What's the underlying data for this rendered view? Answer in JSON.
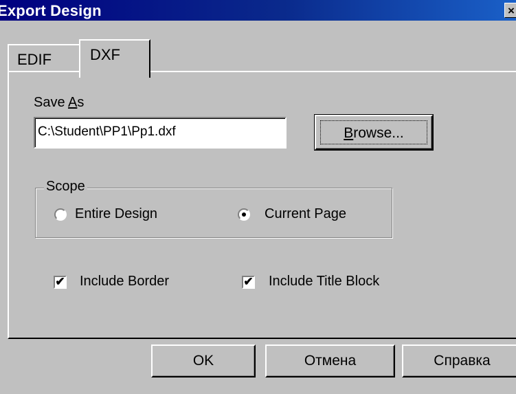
{
  "window": {
    "title": "Export Design",
    "close_glyph": "×"
  },
  "tabs": [
    {
      "label": "EDIF",
      "selected": false
    },
    {
      "label": "DXF",
      "selected": true
    }
  ],
  "save_as": {
    "label_prefix": "Save ",
    "label_mnemonic": "A",
    "label_suffix": "s",
    "value": "C:\\Student\\PP1\\Pp1.dxf"
  },
  "browse_button": {
    "mnemonic": "B",
    "rest": "rowse..."
  },
  "scope": {
    "legend": "Scope",
    "options": [
      {
        "label": "Entire Design",
        "selected": false
      },
      {
        "label": "Current Page",
        "selected": true
      }
    ]
  },
  "checkboxes": [
    {
      "label": "Include Border",
      "checked": true,
      "mark": "✔"
    },
    {
      "label": "Include Title Block",
      "checked": true,
      "mark": "✔"
    }
  ],
  "buttons": {
    "ok": "OK",
    "cancel": "Отмена",
    "help": "Справка"
  }
}
